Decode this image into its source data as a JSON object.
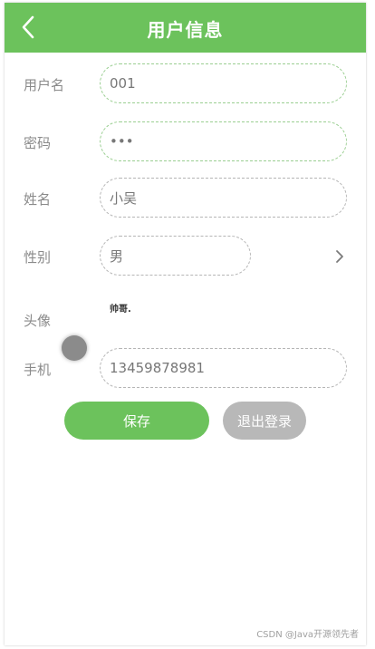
{
  "header": {
    "title": "用户信息"
  },
  "form": {
    "username": {
      "label": "用户名",
      "value": "001"
    },
    "password": {
      "label": "密码",
      "value": "•••"
    },
    "name": {
      "label": "姓名",
      "value": "小吴"
    },
    "gender": {
      "label": "性别",
      "value": "男"
    },
    "avatar": {
      "label": "头像",
      "image_text": "帅哥."
    },
    "phone": {
      "label": "手机",
      "value": "13459878981"
    }
  },
  "buttons": {
    "save": "保存",
    "logout": "退出登录"
  },
  "watermark": "CSDN @Java开源领先者",
  "colors": {
    "accent": "#6cc25c",
    "logout_button": "#b8b8b8"
  },
  "icons": {
    "back": "chevron-left-icon",
    "gender_picker": "chevron-right-icon"
  }
}
